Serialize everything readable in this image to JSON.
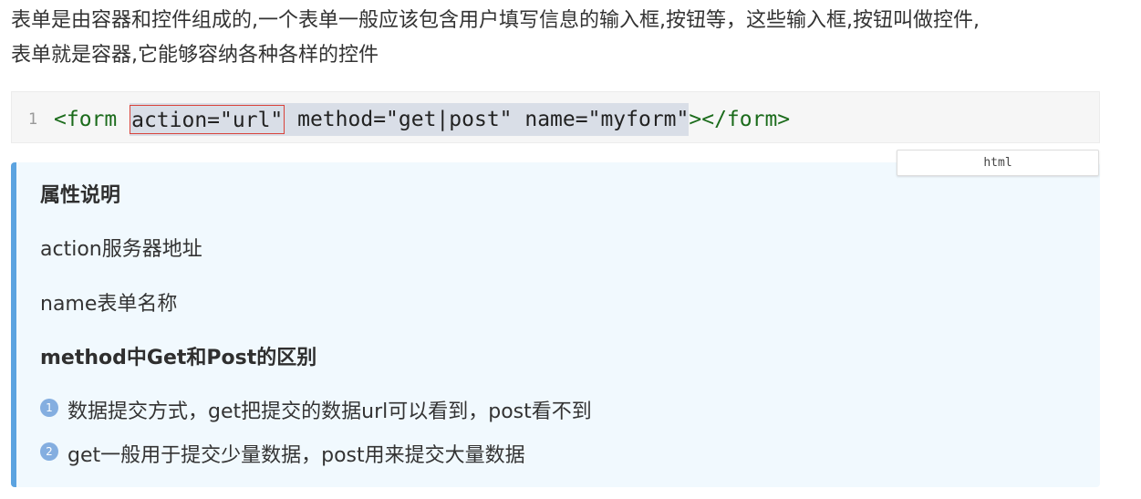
{
  "intro": {
    "line1": "表单是由容器和控件组成的,一个表单一般应该包含用户填写信息的输入框,按钮等，这些输入框,按钮叫做控件,",
    "line2": "表单就是容器,它能够容纳各种各样的控件"
  },
  "code": {
    "line_number": "1",
    "open_tag": "<form ",
    "highlighted_attr": "action=\"url\"",
    "rest_attrs": " method=\"get|post\" name=\"myform\"",
    "close": "></form>",
    "language_label": "html"
  },
  "note": {
    "heading": "属性说明",
    "action_desc": "action服务器地址",
    "name_desc": "name表单名称",
    "method_heading": "method中Get和Post的区别",
    "items": [
      {
        "number": "1",
        "text": "数据提交方式，get把提交的数据url可以看到，post看不到"
      },
      {
        "number": "2",
        "text": "get一般用于提交少量数据，post用来提交大量数据"
      }
    ]
  },
  "colors": {
    "accent_bar": "#5ba3e0",
    "note_background": "#f1f9fe",
    "highlight_border": "#d9423a",
    "tag_color": "#1b6b1b"
  }
}
